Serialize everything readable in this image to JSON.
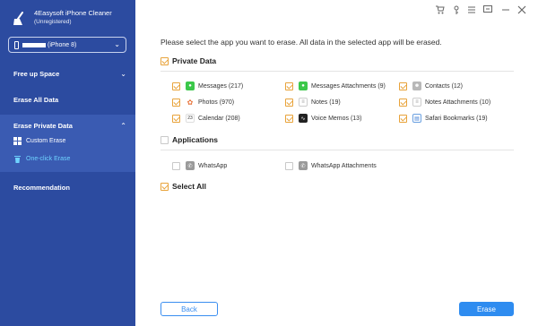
{
  "app": {
    "name": "4Easysoft iPhone Cleaner",
    "status": "(Unregistered)"
  },
  "device": {
    "label": "(iPhone 8)"
  },
  "sidebar": {
    "free_up": "Free up Space",
    "erase_all": "Erase All Data",
    "erase_private": "Erase Private Data",
    "custom_erase": "Custom Erase",
    "one_click": "One-click Erase",
    "recommendation": "Recommendation"
  },
  "main": {
    "instruction": "Please select the app you want to erase. All data in the selected app will be erased.",
    "private_title": "Private Data",
    "private_items": [
      "Messages (217)",
      "Messages Attachments (9)",
      "Contacts (12)",
      "Photos (970)",
      "Notes (19)",
      "Notes Attachments (10)",
      "Calendar (208)",
      "Voice Memos (13)",
      "Safari Bookmarks (19)"
    ],
    "apps_title": "Applications",
    "app_items": [
      "WhatsApp",
      "WhatsApp Attachments"
    ],
    "select_all": "Select All"
  },
  "buttons": {
    "back": "Back",
    "erase": "Erase"
  },
  "colors": {
    "sidebar": "#2c4ba0",
    "accent": "#2e8cf0",
    "check": "#e8a33b",
    "active_text": "#6fd3ff"
  }
}
